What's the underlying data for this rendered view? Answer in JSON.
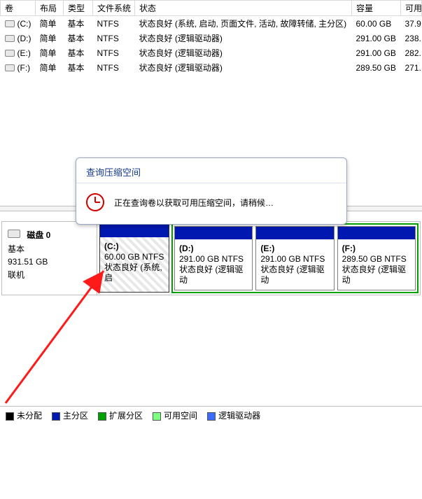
{
  "columns": {
    "vol": "卷",
    "layout": "布局",
    "type": "类型",
    "fs": "文件系统",
    "status": "状态",
    "capacity": "容量",
    "free": "可用"
  },
  "volumes": [
    {
      "drive": "(C:)",
      "layout": "简单",
      "type": "基本",
      "fs": "NTFS",
      "status": "状态良好 (系统, 启动, 页面文件, 活动, 故障转储, 主分区)",
      "capacity": "60.00 GB",
      "free": "37.9"
    },
    {
      "drive": "(D:)",
      "layout": "简单",
      "type": "基本",
      "fs": "NTFS",
      "status": "状态良好 (逻辑驱动器)",
      "capacity": "291.00 GB",
      "free": "238."
    },
    {
      "drive": "(E:)",
      "layout": "简单",
      "type": "基本",
      "fs": "NTFS",
      "status": "状态良好 (逻辑驱动器)",
      "capacity": "291.00 GB",
      "free": "282."
    },
    {
      "drive": "(F:)",
      "layout": "简单",
      "type": "基本",
      "fs": "NTFS",
      "status": "状态良好 (逻辑驱动器)",
      "capacity": "289.50 GB",
      "free": "271."
    }
  ],
  "disk": {
    "name": "磁盘 0",
    "type": "基本",
    "size": "931.51 GB",
    "state": "联机"
  },
  "partitions": {
    "c": {
      "label": "(C:)",
      "line1": "60.00 GB NTFS",
      "line2": "状态良好 (系统, 启"
    },
    "d": {
      "label": "(D:)",
      "line1": "291.00 GB NTFS",
      "line2": "状态良好 (逻辑驱动"
    },
    "e": {
      "label": "(E:)",
      "line1": "291.00 GB NTFS",
      "line2": "状态良好 (逻辑驱动"
    },
    "f": {
      "label": "(F:)",
      "line1": "289.50 GB NTFS",
      "line2": "状态良好 (逻辑驱动"
    }
  },
  "legend": {
    "unalloc": "未分配",
    "primary": "主分区",
    "extended": "扩展分区",
    "free": "可用空间",
    "logical": "逻辑驱动器"
  },
  "dialog": {
    "title": "查询压缩空间",
    "message": "正在查询卷以获取可用压缩空间，请稍候…"
  }
}
